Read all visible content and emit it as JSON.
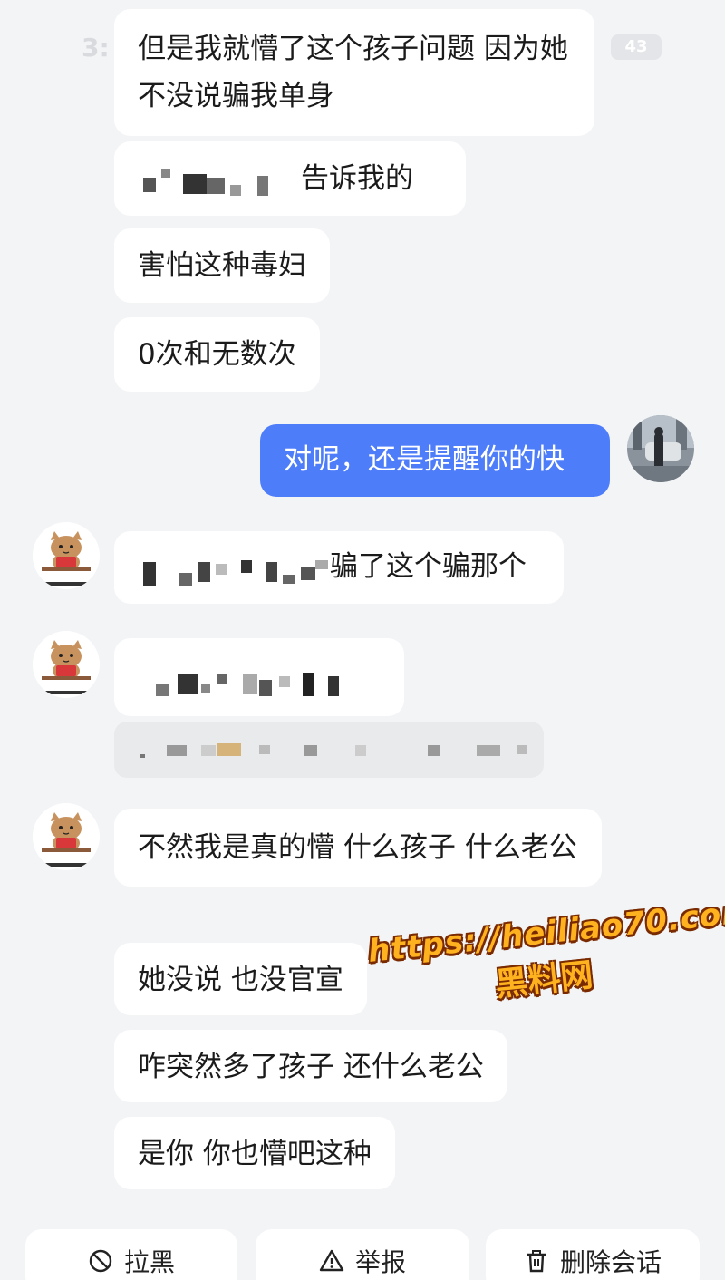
{
  "status_bar": {
    "time": "3:",
    "battery": "43"
  },
  "messages": [
    {
      "text": "但是我就懵了这个孩子问题 因为她不没说骗我单身"
    },
    {
      "text": "告诉我的"
    },
    {
      "text": "害怕这种毒妇"
    },
    {
      "text": "0次和无数次"
    },
    {
      "text": "对呢，还是提醒你的快"
    },
    {
      "text": "骗了这个骗那个"
    },
    {
      "text": "不然我是真的懵 什么孩子 什么老公"
    },
    {
      "text": "她没说 也没官宣"
    },
    {
      "text": "咋突然多了孩子 还什么老公"
    },
    {
      "text": "是你 你也懵吧这种"
    }
  ],
  "actions": {
    "block": "拉黑",
    "report": "举报",
    "delete": "删除会话"
  },
  "watermark": {
    "url": "https://heiliao70.com",
    "site": "黑料网"
  },
  "colors": {
    "background": "#f3f4f6",
    "my_bubble": "#4e7dfa",
    "their_bubble": "#ffffff",
    "watermark": "#ffb21f"
  }
}
